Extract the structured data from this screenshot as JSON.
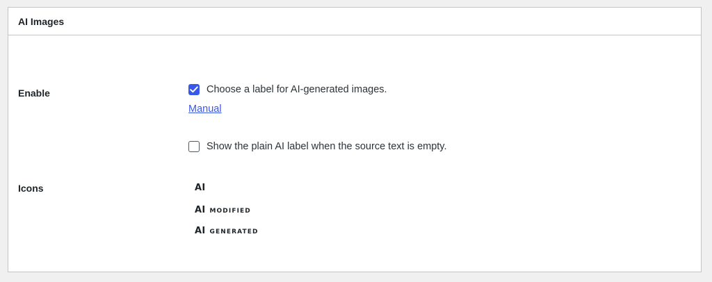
{
  "panel": {
    "title": "AI Images"
  },
  "enable": {
    "label": "Enable",
    "checkbox_label": "Choose a label for AI-generated images.",
    "checkbox_checked": true,
    "manual_link": "Manual",
    "plain_label_checkbox": "Show the plain AI label when the source text is empty.",
    "plain_label_checked": false
  },
  "icons": {
    "label": "Icons",
    "items": [
      {
        "mark": "AI",
        "suffix": ""
      },
      {
        "mark": "AI",
        "suffix": "MODIFIED"
      },
      {
        "mark": "AI",
        "suffix": "GENERATED"
      }
    ]
  },
  "colors": {
    "accent": "#3858e9",
    "border": "#c3c4c7",
    "background": "#f0f0f1"
  }
}
